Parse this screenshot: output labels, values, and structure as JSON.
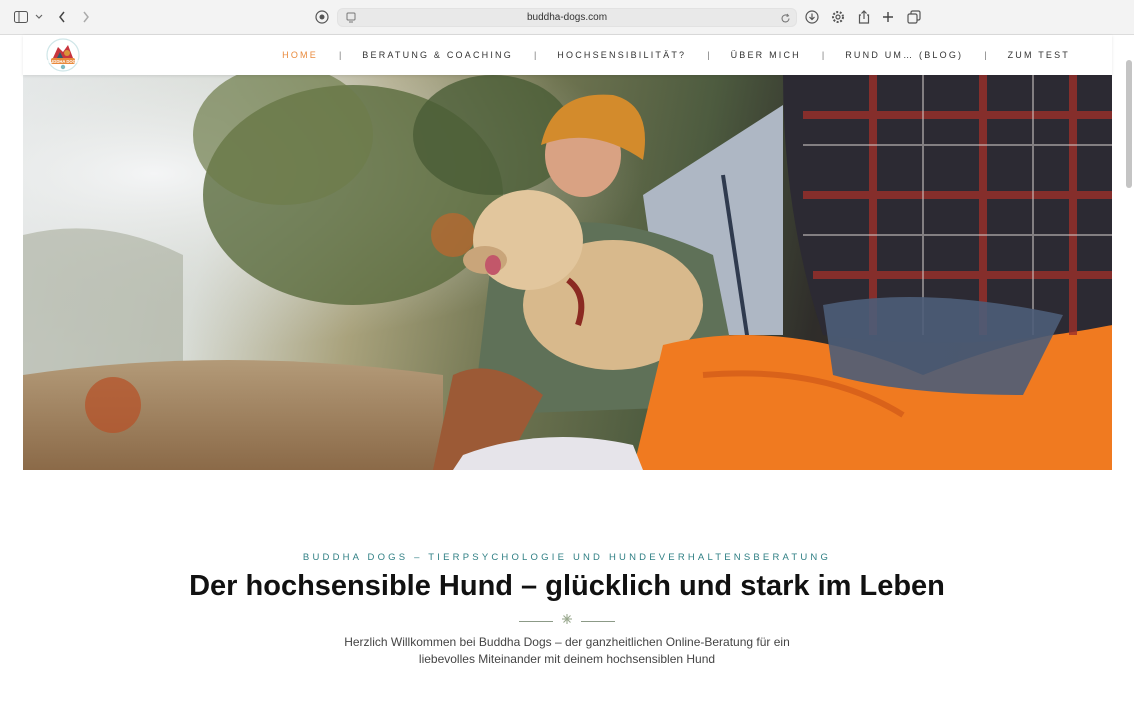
{
  "browser": {
    "url": "buddha-dogs.com",
    "icons": [
      "sidebar-icon",
      "chevron-down-icon",
      "back-icon",
      "forward-icon",
      "shield-icon",
      "page-icon",
      "reload-icon",
      "download-icon",
      "gear-icon",
      "share-icon",
      "plus-icon",
      "tabs-icon"
    ]
  },
  "site": {
    "logo_text": "BUDDHA DOGS",
    "nav": {
      "items": [
        {
          "label": "HOME",
          "active": true
        },
        {
          "label": "BERATUNG & COACHING"
        },
        {
          "label": "HOCHSENSIBILITÄT?"
        },
        {
          "label": "ÜBER MICH"
        },
        {
          "label": "RUND UM… (BLOG)"
        },
        {
          "label": "ZUM TEST"
        }
      ],
      "separator": "|"
    },
    "colors": {
      "accent": "#e98a3c",
      "eyebrow": "#2f7f84"
    }
  },
  "content": {
    "eyebrow": "BUDDHA DOGS – TIERPSYCHOLOGIE UND HUNDEVERHALTENSBERATUNG",
    "headline": "Der hochsensible Hund  – glücklich und stark im Leben",
    "intro_line1": "Herzlich Willkommen bei Buddha Dogs – der ganzheitlichen Online-Beratung für ein",
    "intro_line2": "liebevolles Miteinander mit deinem hochsensiblen Hund"
  }
}
